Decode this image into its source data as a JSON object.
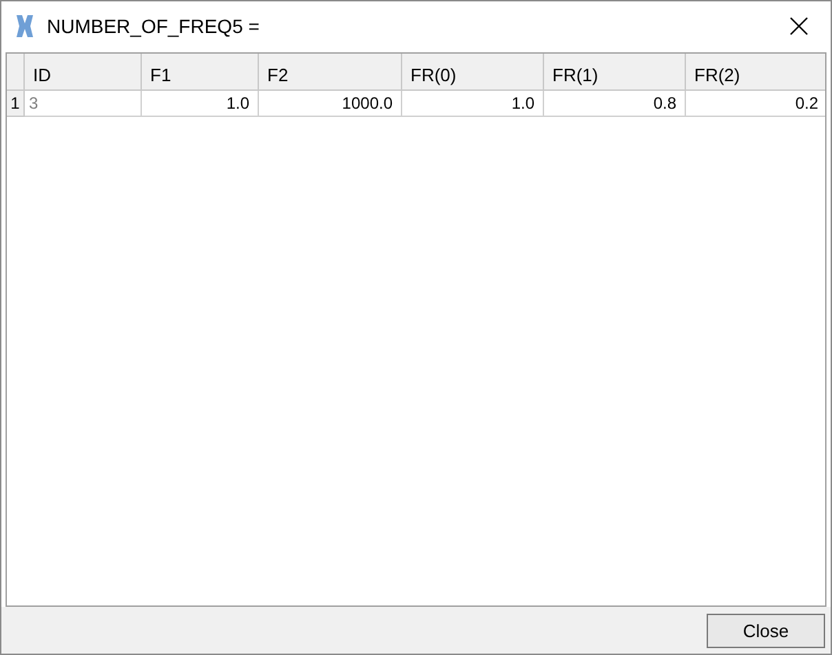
{
  "window": {
    "title": "NUMBER_OF_FREQ5 ="
  },
  "table": {
    "columns": [
      "ID",
      "F1",
      "F2",
      "FR(0)",
      "FR(1)",
      "FR(2)"
    ],
    "rows": [
      {
        "header": "1",
        "cells": [
          "3",
          "1.0",
          "1000.0",
          "1.0",
          "0.8",
          "0.2"
        ]
      }
    ]
  },
  "buttons": [
    "Close"
  ]
}
